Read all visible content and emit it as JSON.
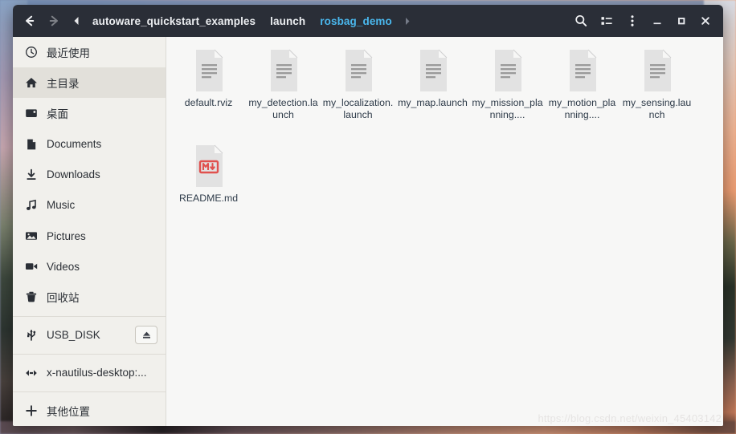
{
  "window": {
    "headerbar": {
      "nav_back": "back-arrow",
      "nav_forward": "forward-arrow",
      "crumb_prev": "◀",
      "crumb_next": "▶",
      "breadcrumbs": [
        {
          "label": "autoware_quickstart_examples",
          "active": false
        },
        {
          "label": "launch",
          "active": false
        },
        {
          "label": "rosbag_demo",
          "active": true
        }
      ],
      "active_crumb_color": "#4ab8ee",
      "background_color": "#2a2e37",
      "actions": [
        {
          "name": "search-button",
          "icon": "search-icon"
        },
        {
          "name": "view-options-button",
          "icon": "list-view-icon"
        },
        {
          "name": "menu-button",
          "icon": "kebab-menu-icon"
        }
      ],
      "window_controls": [
        {
          "name": "minimize-button",
          "icon": "minimize-icon"
        },
        {
          "name": "maximize-button",
          "icon": "maximize-icon"
        },
        {
          "name": "close-button",
          "icon": "close-icon"
        }
      ]
    },
    "sidebar": {
      "groups": [
        {
          "items": [
            {
              "label": "最近使用",
              "icon": "clock-icon",
              "selected": false
            },
            {
              "label": "主目录",
              "icon": "home-icon",
              "selected": true
            },
            {
              "label": "桌面",
              "icon": "desktop-icon",
              "selected": false
            },
            {
              "label": "Documents",
              "icon": "document-icon",
              "selected": false
            },
            {
              "label": "Downloads",
              "icon": "download-icon",
              "selected": false
            },
            {
              "label": "Music",
              "icon": "music-note-icon",
              "selected": false
            },
            {
              "label": "Pictures",
              "icon": "picture-icon",
              "selected": false
            },
            {
              "label": "Videos",
              "icon": "video-camera-icon",
              "selected": false
            },
            {
              "label": "回收站",
              "icon": "trash-icon",
              "selected": false
            }
          ]
        },
        {
          "items": [
            {
              "label": "USB_DISK",
              "icon": "usb-icon",
              "selected": false,
              "eject": true
            }
          ]
        },
        {
          "items": [
            {
              "label": "x-nautilus-desktop:...",
              "icon": "network-icon",
              "selected": false
            }
          ]
        },
        {
          "items": [
            {
              "label": "其他位置",
              "icon": "plus-icon",
              "selected": false
            }
          ]
        }
      ]
    },
    "content": {
      "files": [
        {
          "name": "default.rviz",
          "type": "text-file"
        },
        {
          "name": "my_detection.launch",
          "type": "text-file"
        },
        {
          "name": "my_localization.launch",
          "type": "text-file"
        },
        {
          "name": "my_map.launch",
          "type": "text-file"
        },
        {
          "name": "my_mission_planning....",
          "type": "text-file"
        },
        {
          "name": "my_motion_planning....",
          "type": "text-file"
        },
        {
          "name": "my_sensing.launch",
          "type": "text-file"
        },
        {
          "name": "README.md",
          "type": "markdown-file"
        }
      ],
      "watermark": "https://blog.csdn.net/weixin_45403142"
    }
  }
}
